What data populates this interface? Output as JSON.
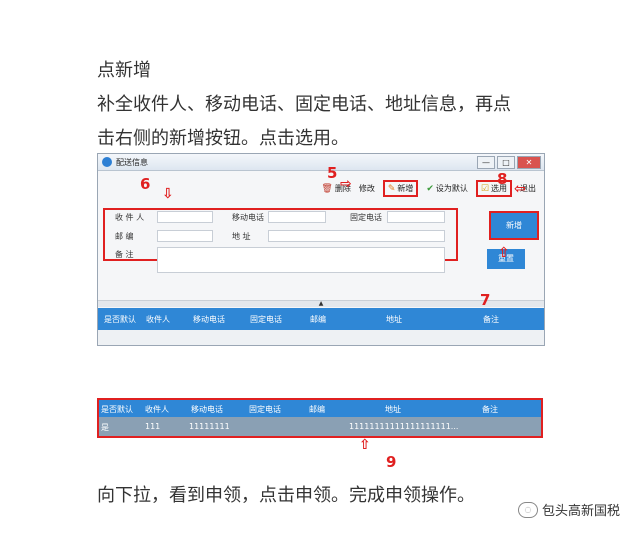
{
  "article": {
    "line1": "点新增",
    "line2": "补全收件人、移动电话、固定电话、地址信息，再点",
    "line3": "击右侧的新增按钮。点击选用。",
    "line4": "向下拉，看到申领，点击申领。完成申领操作。"
  },
  "window": {
    "title": "配送信息",
    "controls": [
      "—",
      "□",
      "✕"
    ],
    "toolbar": {
      "delete": "删除",
      "edit": "修改",
      "add": "新增",
      "set_default": "设为默认",
      "select": "选用",
      "exit": "退出"
    },
    "form": {
      "recipient_label": "收 件 人",
      "mobile_label": "移动电话",
      "landline_label": "固定电话",
      "postcode_label": "邮 编",
      "address_label": "地 址",
      "remark_label": "备 注"
    },
    "buttons": {
      "new": "新增",
      "reset": "重置"
    },
    "splitter_glyph": "▲",
    "grid_columns": [
      "是否默认",
      "收件人",
      "移动电话",
      "固定电话",
      "邮编",
      "地址",
      "备注"
    ]
  },
  "grid2": {
    "columns": [
      "是否默认",
      "收件人",
      "移动电话",
      "固定电话",
      "邮编",
      "地址",
      "备注"
    ],
    "row": {
      "default": "是",
      "recipient": "111",
      "mobile": "11111111",
      "landline": "",
      "postcode": "",
      "address": "11111111111111111111...",
      "remark": ""
    }
  },
  "annotations": [
    "5",
    "6",
    "7",
    "8",
    "9"
  ],
  "watermark": "包头高新国税",
  "colors": {
    "accent": "#2f87d6",
    "annotation": "#e02020"
  }
}
